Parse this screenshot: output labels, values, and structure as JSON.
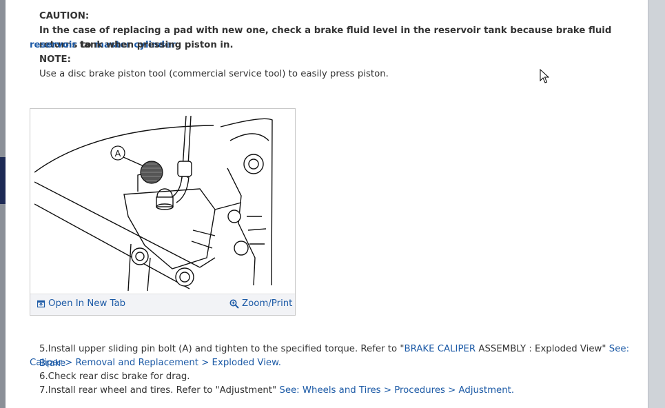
{
  "caution": {
    "heading": "CAUTION:",
    "text_before_link": "In the case of replacing a pad with new one, check a brake fluid level in the reservoir tank because brake fluid returns to ",
    "link_part1": "master cylinder",
    "link_part2": "reservoir",
    "text_after_link": " tank when pressing piston in."
  },
  "note": {
    "heading": "NOTE:",
    "text": "Use a disc brake piston tool (commercial service tool) to easily press piston."
  },
  "figure": {
    "callout_label": "A",
    "open_new_tab": "Open In New Tab",
    "zoom_print": "Zoom/Print"
  },
  "steps": {
    "s5_text": "5.Install upper sliding pin bolt (A) and tighten to the specified torque. Refer to \"",
    "s5_link_inline": "BRAKE CALIPER",
    "s5_text2": " ASSEMBLY : Exploded View\" ",
    "s5_link_part1": "See: Brake",
    "s5_link_part2": "Caliper > Removal and Replacement > Exploded View",
    "s6_text": "6.Check rear disc brake for drag.",
    "s7_text": "7.Install rear wheel and tires. Refer to \"Adjustment\" ",
    "s7_link": "See: Wheels and Tires > Procedures > Adjustment"
  },
  "colors": {
    "link": "#1c5aa6",
    "text": "#333333"
  }
}
